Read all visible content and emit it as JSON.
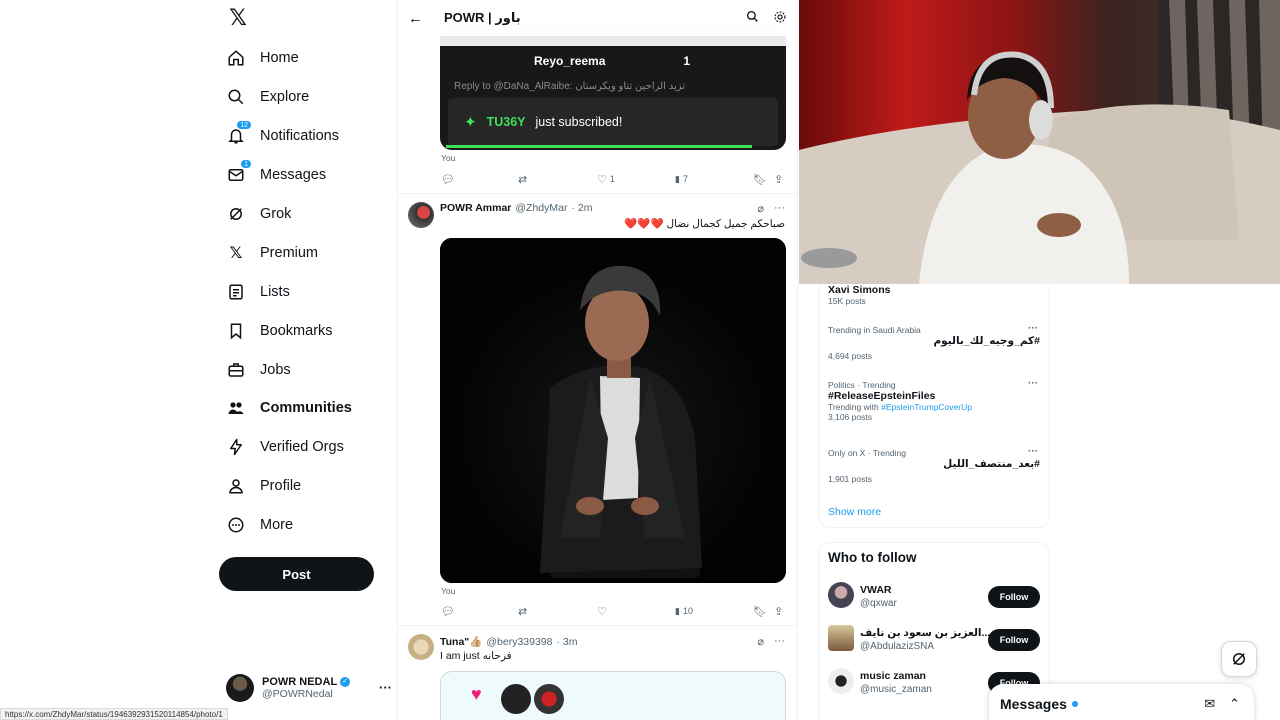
{
  "nav": {
    "items": [
      {
        "label": "Home",
        "icon": "home-icon"
      },
      {
        "label": "Explore",
        "icon": "search-icon"
      },
      {
        "label": "Notifications",
        "icon": "bell-icon",
        "badge": "12"
      },
      {
        "label": "Messages",
        "icon": "mail-icon",
        "badge": "1"
      },
      {
        "label": "Grok",
        "icon": "grok-icon"
      },
      {
        "label": "Premium",
        "icon": "x-logo-icon"
      },
      {
        "label": "Lists",
        "icon": "list-icon"
      },
      {
        "label": "Bookmarks",
        "icon": "bookmark-icon"
      },
      {
        "label": "Jobs",
        "icon": "briefcase-icon"
      },
      {
        "label": "Communities",
        "icon": "people-icon",
        "active": true
      },
      {
        "label": "Verified Orgs",
        "icon": "lightning-icon"
      },
      {
        "label": "Profile",
        "icon": "person-icon"
      },
      {
        "label": "More",
        "icon": "more-circle-icon"
      }
    ],
    "post_label": "Post",
    "profile": {
      "name": "POWR NEDAL",
      "handle": "@POWRNedal"
    }
  },
  "header": {
    "title": "POWR | باور"
  },
  "feed": {
    "embed": {
      "reyo_name": "Reyo_reema",
      "reyo_count": "1",
      "reply_text": "Reply to @DaNa_AlRaibe: تزيد الراحين تتاو ويكرستان",
      "sub_user": "TU36Y",
      "sub_text": "just subscribed!"
    },
    "post1": {
      "you_label": "You",
      "likes": "1",
      "views": "7"
    },
    "post2": {
      "name": "POWR Ammar",
      "handle": "@ZhdyMar",
      "time": "· 2m",
      "text": "صباحكم جميل كجمال نضال ❤️❤️❤️",
      "you_label": "You",
      "views": "10"
    },
    "post3": {
      "name": "Tuna\"👍🏼",
      "handle": "@bery339398",
      "time": "· 3m",
      "text": "I am just فرحانه"
    }
  },
  "trends": [
    {
      "category": "",
      "name": "Xavi Simons",
      "count": "15K posts"
    },
    {
      "category": "Trending in Saudi Arabia",
      "name": "#كم_وجيه_لك_باليوم",
      "count": "4,694 posts"
    },
    {
      "category": "Politics · Trending",
      "name": "#ReleaseEpsteinFiles",
      "with_prefix": "Trending with",
      "with_tag": "#EpsteinTrumpCoverUp",
      "count": "3,106 posts"
    },
    {
      "category": "Only on X · Trending",
      "name": "#بعد_منتصف_الليل",
      "count": "1,901 posts"
    }
  ],
  "show_more": "Show more",
  "who_to_follow": {
    "title": "Who to follow",
    "follow_label": "Follow",
    "accounts": [
      {
        "name": "VWAR",
        "handle": "@qxwar"
      },
      {
        "name": "العزيز بن سعود بن نايف...",
        "handle": "@AbdulazizSNA"
      },
      {
        "name": "music zaman",
        "handle": "@music_zaman"
      }
    ]
  },
  "messages_drawer": {
    "title": "Messages"
  },
  "status_url": "https://x.com/ZhdyMar/status/1946392931520114854/photo/1",
  "colors": {
    "accent": "#1d9bf0",
    "sub_green": "#3ee05c",
    "dark": "#0f1419"
  }
}
